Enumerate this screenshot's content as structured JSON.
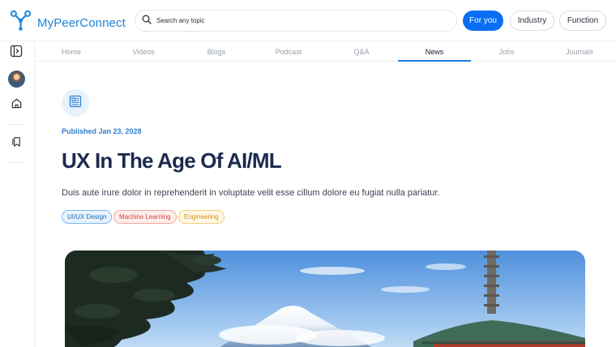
{
  "app": {
    "name": "MyPeerConnect",
    "logo_icon": "peer-network-logo-icon"
  },
  "search": {
    "placeholder": "Search any topic",
    "icon": "search-icon"
  },
  "header_filters": [
    {
      "label": "For you",
      "active": true
    },
    {
      "label": "Industry",
      "active": false
    },
    {
      "label": "Function",
      "active": false
    }
  ],
  "sidebar": {
    "items": [
      {
        "icon": "sidebar-toggle-icon"
      },
      {
        "icon": "profile-avatar"
      },
      {
        "icon": "home-icon"
      },
      {
        "icon": "bookmarks-icon"
      }
    ]
  },
  "tabs": [
    {
      "label": "Home",
      "active": false
    },
    {
      "label": "Videos",
      "active": false
    },
    {
      "label": "Blogs",
      "active": false
    },
    {
      "label": "Podcast",
      "active": false
    },
    {
      "label": "Q&A",
      "active": false
    },
    {
      "label": "News",
      "active": true
    },
    {
      "label": "Jobs",
      "active": false
    },
    {
      "label": "Journals",
      "active": false
    }
  ],
  "article": {
    "badge_icon": "newspaper-icon",
    "published": "Published Jan 23, 2028",
    "title": "UX In The Age Of AI/ML",
    "subtitle": "Duis aute irure dolor in reprehenderit in voluptate velit esse cillum dolore eu fugiat nulla pariatur.",
    "tags": [
      {
        "label": "UI/UX Design",
        "color": "#1c69b5"
      },
      {
        "label": "Machine Learning",
        "color": "#d2463b"
      },
      {
        "label": "Engineering",
        "color": "#d3911a"
      }
    ],
    "hero_image": "mount-fuji-with-pagoda"
  },
  "colors": {
    "brand": "#1e84d8",
    "primary": "#0a6ef3",
    "title": "#1b2a4e",
    "tab_active_underline": "#1f80d9"
  }
}
